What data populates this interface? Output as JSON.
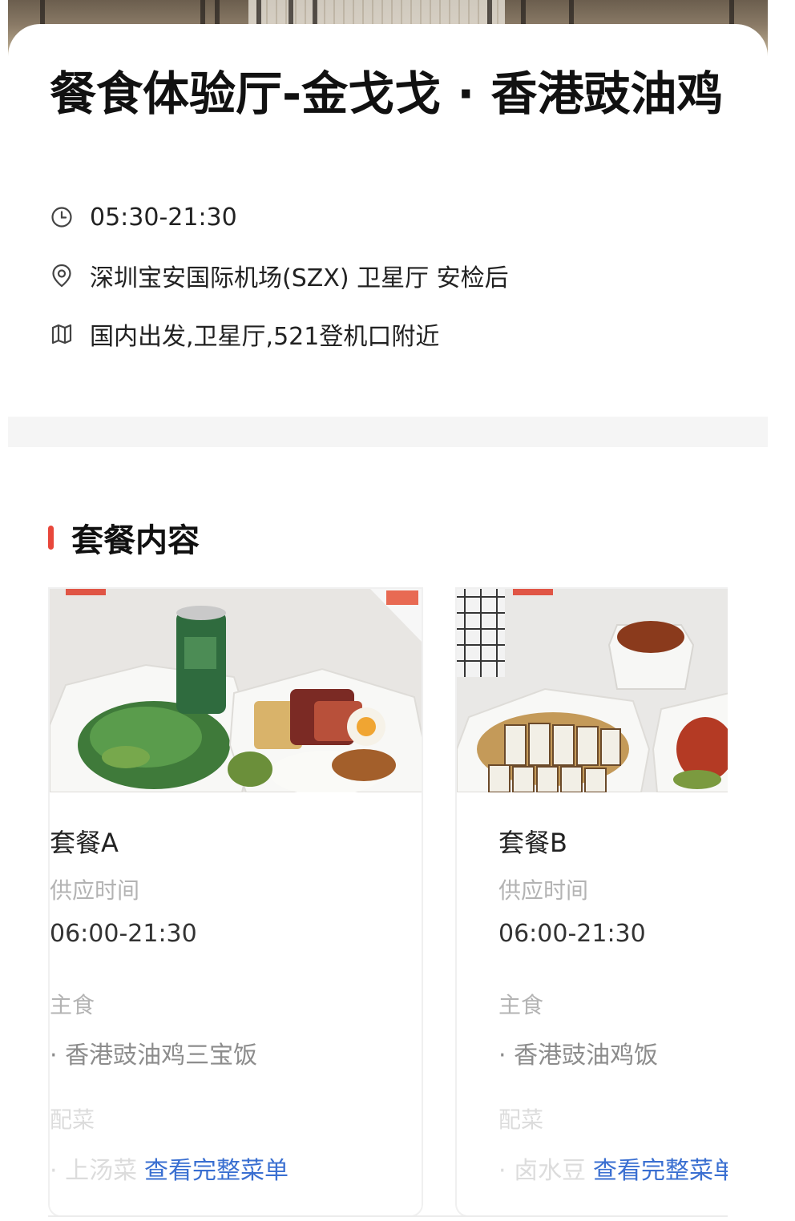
{
  "venue": {
    "title": "餐食体验厅-金戈戈 · 香港豉油鸡",
    "hours": "05:30-21:30",
    "address": "深圳宝安国际机场(SZX) 卫星厅 安检后",
    "location_hint": "国内出发,卫星厅,521登机口附近"
  },
  "icons": {
    "hours": "clock-icon",
    "address": "location-pin-icon",
    "location_hint": "map-icon"
  },
  "section": {
    "title": "套餐内容",
    "accent_color": "#e8473b"
  },
  "packages": [
    {
      "name": "套餐A",
      "supply_time_label": "供应时间",
      "supply_time": "06:00-21:30",
      "main_label": "主食",
      "main_item": "· 香港豉油鸡三宝饭",
      "side_label": "配菜",
      "side_item": "· 上汤菜",
      "full_menu_link": "查看完整菜单"
    },
    {
      "name": "套餐B",
      "supply_time_label": "供应时间",
      "supply_time": "06:00-21:30",
      "main_label": "主食",
      "main_item": "· 香港豉油鸡饭",
      "side_label": "配菜",
      "side_item": "· 卤水豆",
      "full_menu_link": "查看完整菜单"
    }
  ],
  "colors": {
    "link": "#3a6fd1",
    "muted": "#b3b3b3"
  }
}
